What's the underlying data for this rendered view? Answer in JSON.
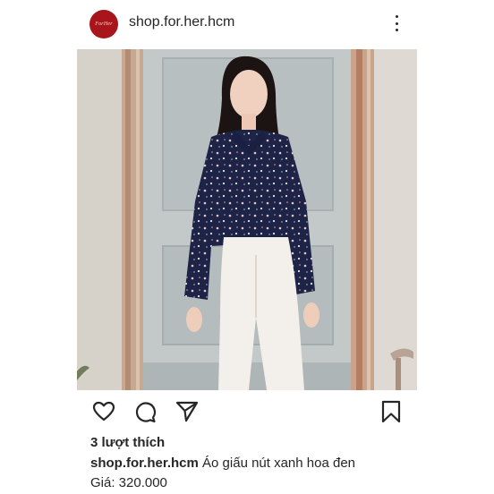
{
  "post": {
    "avatar_text": "ForHer",
    "username": "shop.for.her.hcm",
    "likes": "3 lượt thích",
    "caption_user": "shop.for.her.hcm",
    "caption_text": "Áo giấu nút xanh hoa đen",
    "price": "Giá: 320.000"
  },
  "icons": {
    "more": "more-vertical-icon",
    "like": "heart-icon",
    "comment": "comment-icon",
    "share": "send-icon",
    "save": "bookmark-icon"
  },
  "colors": {
    "brand": "#a8151b",
    "text": "#262626"
  }
}
